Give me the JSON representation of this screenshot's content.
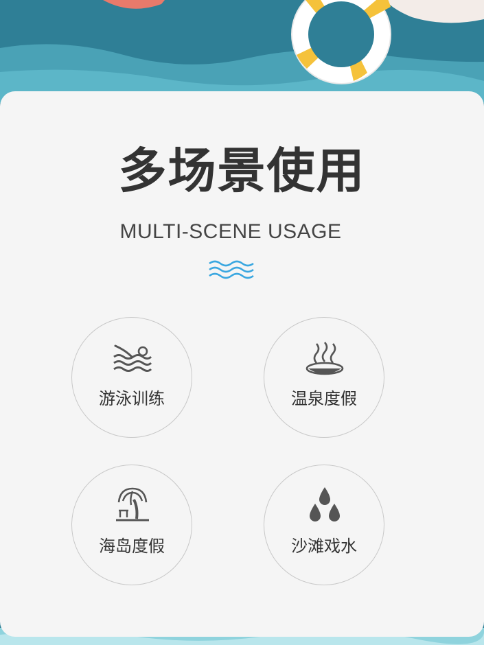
{
  "colors": {
    "sea_dark": "#2f7f96",
    "sea_mid": "#4aa2b6",
    "sea_light": "#6dc3d3",
    "card_bg": "#f5f5f5",
    "accent_blue": "#3aa7e0",
    "float_yellow": "#f5c23b"
  },
  "heading": {
    "title": "多场景使用",
    "subtitle": "MULTI-SCENE USAGE",
    "divider_icon": "wave-lines-icon"
  },
  "scenes": [
    {
      "label": "游泳训练",
      "icon": "swimmer-icon"
    },
    {
      "label": "温泉度假",
      "icon": "hot-spring-icon"
    },
    {
      "label": "海岛度假",
      "icon": "palm-tree-icon"
    },
    {
      "label": "沙滩戏水",
      "icon": "water-drops-icon"
    }
  ]
}
